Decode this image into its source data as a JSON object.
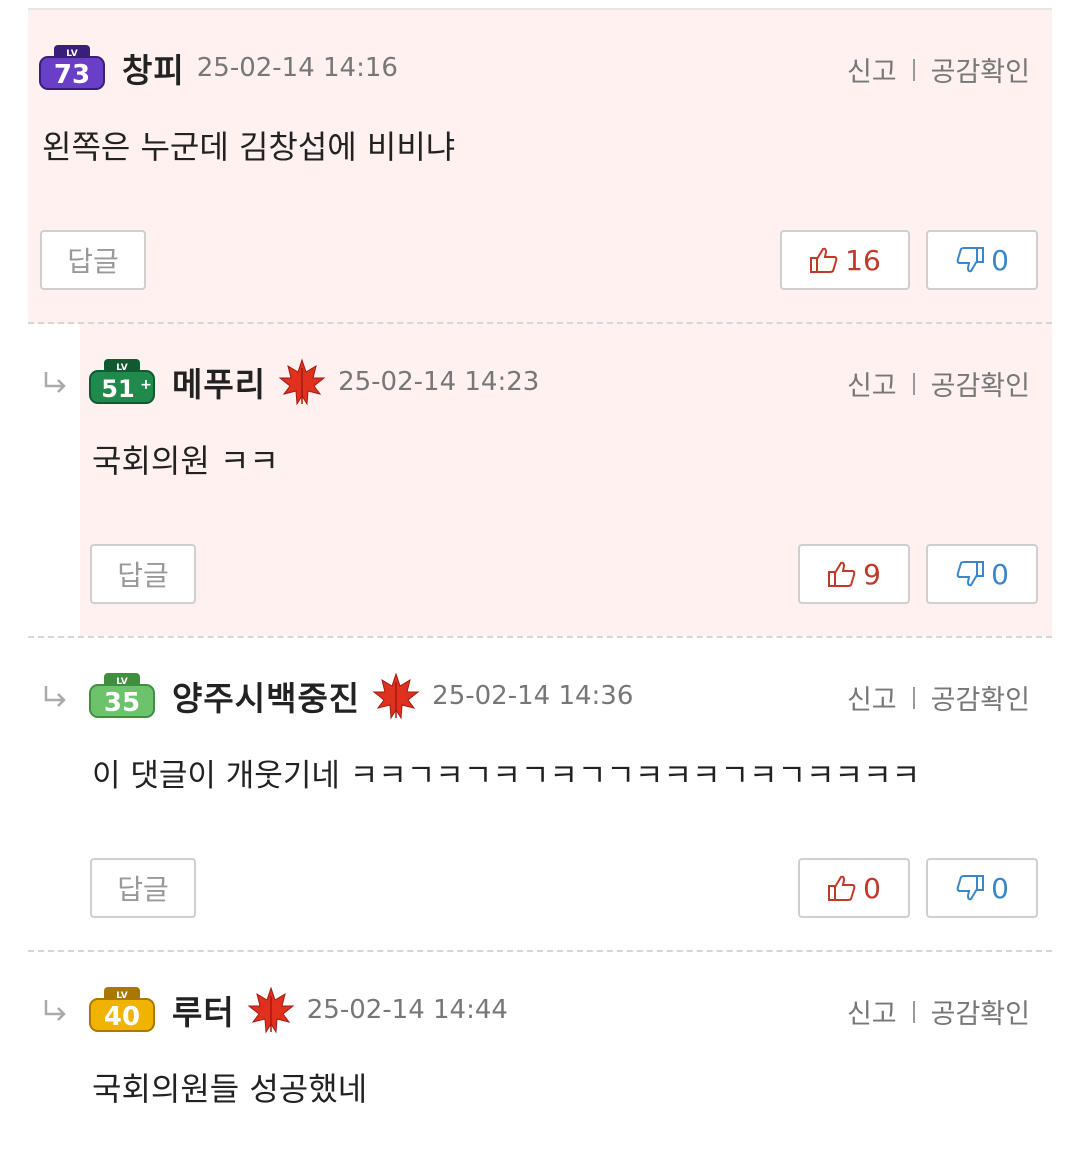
{
  "actions": {
    "report": "신고",
    "empathy": "공감확인",
    "reply": "답글"
  },
  "comments": [
    {
      "level": "73",
      "nickname": "창피",
      "date": "25-02-14 14:16",
      "text": "왼쪽은 누군데 김창섭에 비비냐",
      "likes": "16",
      "dislikes": "0",
      "is_reply": false,
      "badge_color": "#6a3fc8"
    },
    {
      "level": "51",
      "nickname": "메푸리",
      "date": "25-02-14 14:23",
      "text": "국회의원 ㅋㅋ",
      "likes": "9",
      "dislikes": "0",
      "is_reply": true,
      "badge_color": "#1f8a4c"
    },
    {
      "level": "35",
      "nickname": "양주시백중진",
      "date": "25-02-14 14:36",
      "text": "이 댓글이 개웃기네 ㅋㅋㄱㅋㄱㅋㄱㅋㄱㄱㅋㅋㅋㄱㅋㄱㅋㅋㅋㅋ",
      "likes": "0",
      "dislikes": "0",
      "is_reply": true,
      "badge_color": "#6cc36c"
    },
    {
      "level": "40",
      "nickname": "루터",
      "date": "25-02-14 14:44",
      "text": "국회의원들 성공했네",
      "is_reply": true,
      "badge_color": "#f0b400"
    }
  ]
}
